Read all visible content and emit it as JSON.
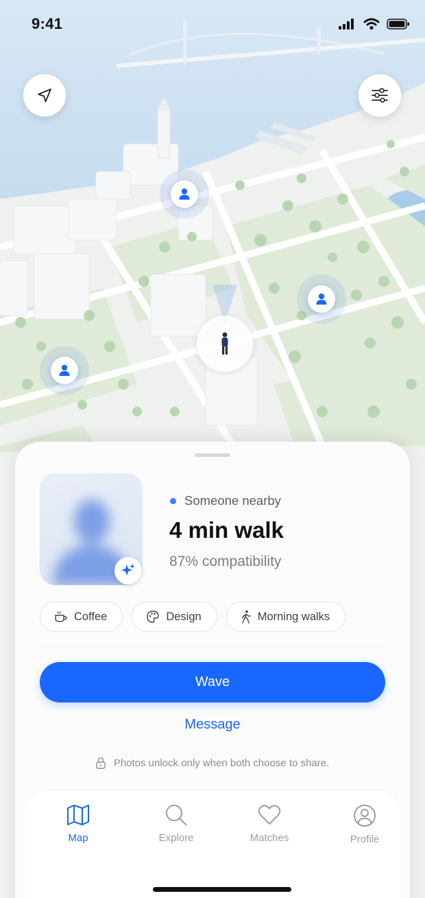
{
  "status_bar": {
    "time": "9:41"
  },
  "map_controls": {
    "locate_icon": "navigation-arrow-icon",
    "filter_icon": "sliders-icon"
  },
  "profile_card": {
    "nearby_label": "Someone nearby",
    "distance": "4 min walk",
    "compatibility": "87% compatibility",
    "badge_icon": "sparkle-icon",
    "tags": [
      {
        "label": "Coffee",
        "icon": "coffee-cup-icon"
      },
      {
        "label": "Design",
        "icon": "palette-icon"
      },
      {
        "label": "Morning walks",
        "icon": "walking-person-icon"
      }
    ],
    "primary_action": "Wave",
    "secondary_action": "Message",
    "privacy_note": "Photos unlock only when both choose to share."
  },
  "tab_bar": {
    "items": [
      {
        "label": "Map",
        "icon": "map-icon",
        "active": true
      },
      {
        "label": "Explore",
        "icon": "search-icon",
        "active": false
      },
      {
        "label": "Matches",
        "icon": "heart-icon",
        "active": false
      },
      {
        "label": "Profile",
        "icon": "user-circle-icon",
        "active": false
      }
    ]
  },
  "colors": {
    "accent": "#1967ff",
    "link": "#1a66f0",
    "presence_dot": "#3d7bf5",
    "water": "#cfe1f1",
    "park": "#dde9d6"
  }
}
